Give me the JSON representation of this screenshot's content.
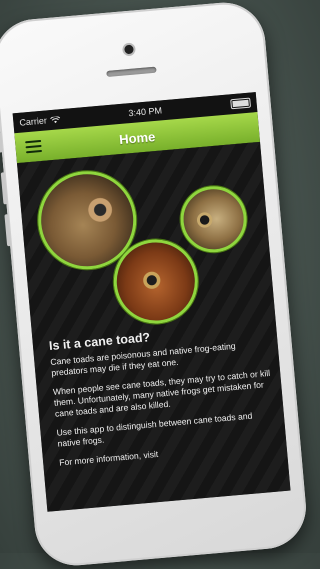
{
  "status_bar": {
    "carrier": "Carrier",
    "time": "3:40 PM"
  },
  "nav": {
    "title": "Home",
    "menu_icon": "hamburger-menu-icon"
  },
  "frog_images": [
    {
      "label": "cane-toad-photo-1"
    },
    {
      "label": "frog-photo-2"
    },
    {
      "label": "frog-photo-3"
    }
  ],
  "content": {
    "heading": "Is it a cane toad?",
    "paragraphs": [
      "Cane toads are poisonous and native frog-eating predators may die if they eat one.",
      "When people see cane toads, they may try to catch or kill them. Unfortunately, many native frogs get mistaken for cane toads and are also killed.",
      "Use this app to distinguish between cane toads and native frogs.",
      "For more information, visit"
    ]
  },
  "colors": {
    "accent": "#8fd63e",
    "nav_top": "#a6d84a",
    "nav_bottom": "#78b02b",
    "screen_bg": "#1a1c1c"
  }
}
